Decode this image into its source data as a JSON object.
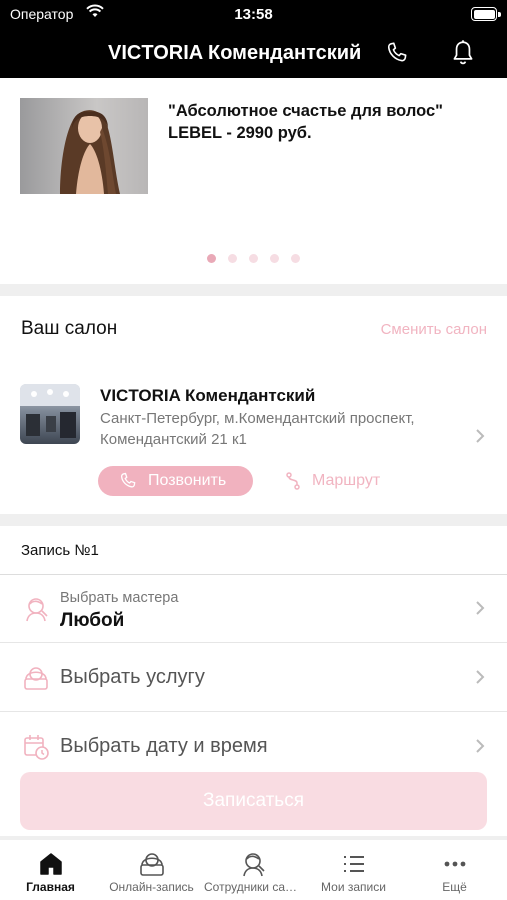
{
  "status_bar": {
    "carrier": "Оператор",
    "time": "13:58"
  },
  "header": {
    "title": "VICTORIA Комендантский"
  },
  "promo": {
    "text": "\"Абсолютное счастье для волос\" LEBEL - 2990 руб.",
    "dots": 5,
    "active_dot": 1
  },
  "salon": {
    "heading": "Ваш салон",
    "change_label": "Сменить салон",
    "name": "VICTORIA Комендантский",
    "address": "Санкт-Петербург, м.Комендантский проспект, Комендантский 21 к1",
    "call_label": "Позвонить",
    "route_label": "Маршрут"
  },
  "booking": {
    "number_label": "Запись №1",
    "master_label": "Выбрать мастера",
    "master_value": "Любой",
    "service_label": "Выбрать услугу",
    "datetime_label": "Выбрать дату и время",
    "submit_label": "Записаться"
  },
  "tabs": [
    {
      "label": "Главная",
      "icon": "home-icon",
      "active": true
    },
    {
      "label": "Онлайн-запись",
      "icon": "online-booking-icon",
      "active": false
    },
    {
      "label": "Сотрудники салона",
      "icon": "staff-icon",
      "active": false
    },
    {
      "label": "Мои записи",
      "icon": "list-icon",
      "active": false
    },
    {
      "label": "Ещё",
      "icon": "more-icon",
      "active": false
    }
  ],
  "colors": {
    "accent": "#f1b2bf",
    "accent_light": "#f9dce2",
    "header_bg": "#000000"
  }
}
